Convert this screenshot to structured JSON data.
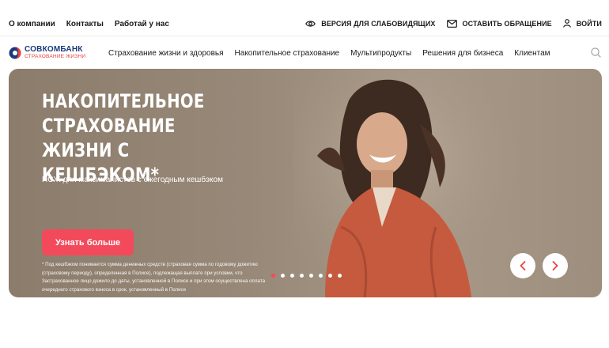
{
  "topbar": {
    "links": [
      "О компании",
      "Контакты",
      "Работай у нас"
    ],
    "accessibility_label": "ВЕРСИЯ ДЛЯ СЛАБОВИДЯЩИХ",
    "appeal_label": "ОСТАВИТЬ ОБРАЩЕНИЕ",
    "login_label": "ВОЙТИ"
  },
  "logo": {
    "name": "СОВКОМБАНК",
    "sub": "СТРАХОВАНИЕ ЖИЗНИ"
  },
  "menu": {
    "items": [
      "Страхование жизни и здоровья",
      "Накопительное страхование",
      "Мультипродукты",
      "Решения для бизнеса",
      "Клиентам"
    ]
  },
  "hero": {
    "title": "НАКОПИТЕЛЬНОЕ СТРАХОВАНИЕ ЖИЗНИ С КЕШБЭКОМ*",
    "subtitle": "НСЖ для максималистов с ежегодным кешбэком",
    "cta_label": "Узнать больше",
    "footnote": "* Под кешбэком понимается сумма денежных средств (страховая сумма по годовому дожитию (страховому периоду), определенная в Полисе), подлежащая выплате при условии, что Застрахованное лицо дожило до даты, установленной в Полисе и при этом осуществлена оплата очередного страхового взноса в срок, установленный в Полисе",
    "slides_total": 8,
    "slide_active": 1
  },
  "colors": {
    "brand_blue": "#1b3a7a",
    "brand_red": "#e8423f",
    "cta": "#f24a5a"
  }
}
